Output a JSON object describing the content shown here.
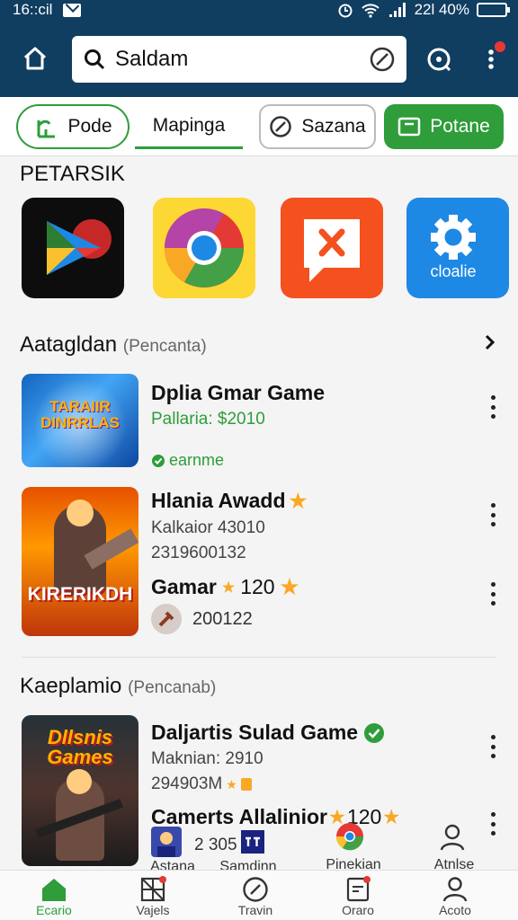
{
  "status": {
    "time": "16::cil",
    "right_text": "22l 40%",
    "icons": [
      "mail-icon",
      "alarm-icon",
      "wifi-icon",
      "signal-icon",
      "battery-icon"
    ]
  },
  "header": {
    "search_value": "Saldam",
    "icons": [
      "home-icon",
      "search-icon",
      "compass-icon",
      "refresh-icon",
      "more-icon"
    ]
  },
  "tabs": [
    {
      "label": "Pode",
      "icon": "plant-icon"
    },
    {
      "label": "Mapinga"
    },
    {
      "label": "Sazana",
      "icon": "block-icon"
    },
    {
      "label": "Potane",
      "icon": "wallet-icon"
    }
  ],
  "section1": {
    "title": "PETARSIK",
    "apps": [
      {
        "name": "play-store-icon"
      },
      {
        "name": "chrome-icon"
      },
      {
        "name": "message-x-icon"
      },
      {
        "name": "settings-app-icon",
        "label": "cloalie"
      }
    ]
  },
  "section2": {
    "title": "Aatagldan",
    "subtitle": "(Pencanta)"
  },
  "cards": [
    {
      "thumb_text": "TARAIIR DINRRLAS",
      "title": "Dplia Gmar Game",
      "meta1": "Pallaria: $2010",
      "tag": "earnme"
    },
    {
      "thumb_text": "KIRERIKDH",
      "title": "Hlania Awadd",
      "meta1": "Kalkaior 43010",
      "meta2": "2319600132",
      "row2_title": "Gamar",
      "row2_rating": "120",
      "row2_meta": "200122"
    }
  ],
  "section3": {
    "title": "Kaeplamio",
    "subtitle": "(Pencanab)"
  },
  "card3": {
    "thumb_text": "Dllsnis Games",
    "title": "Daljartis Sulad Game",
    "meta1": "Maknian: 2910",
    "meta2": "294903M",
    "row2_title": "Camerts Allalinior",
    "row2_rating": "120",
    "row2_meta": "2 305"
  },
  "bottom_labels_upper": [
    "Astana",
    "Samdinn",
    "Pinekian",
    "Atnlse"
  ],
  "bottom_nav": [
    {
      "label": "Ecario",
      "icon": "home-icon",
      "active": true
    },
    {
      "label": "Vajels",
      "icon": "grid-icon"
    },
    {
      "label": "Travin",
      "icon": "compass-icon"
    },
    {
      "label": "Oraro",
      "icon": "inbox-icon"
    },
    {
      "label": "Acoto",
      "icon": "person-icon"
    }
  ],
  "colors": {
    "header": "#103e60",
    "accent": "#2e9d3a"
  }
}
